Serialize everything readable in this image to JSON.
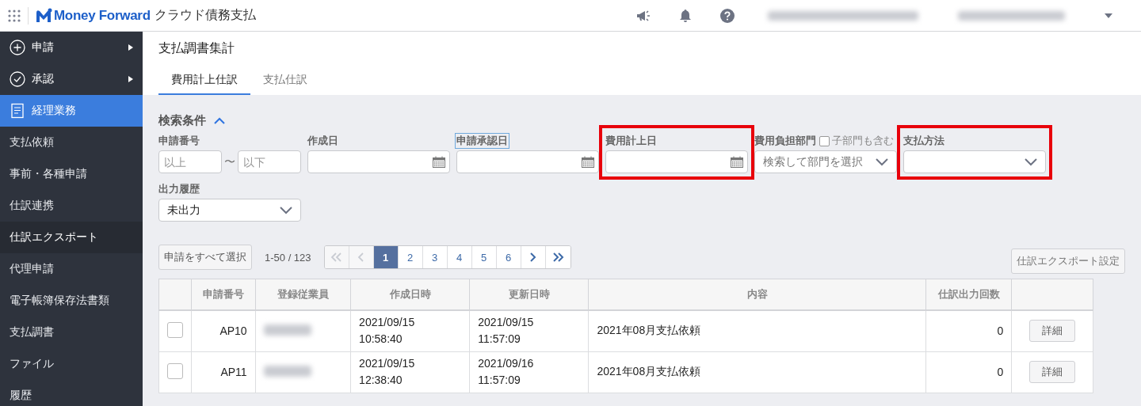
{
  "header": {
    "logo_text": "Money Forward",
    "app_name": "クラウド債務支払"
  },
  "sidebar": {
    "items": [
      {
        "label": "申請",
        "kind": "expandable"
      },
      {
        "label": "承認",
        "kind": "expandable"
      },
      {
        "label": "経理業務",
        "kind": "section",
        "selected": true
      },
      {
        "label": "支払依頼",
        "kind": "link",
        "selected": false
      },
      {
        "label": "事前・各種申請",
        "kind": "link",
        "selected": false
      },
      {
        "label": "仕訳連携",
        "kind": "link",
        "selected": false
      },
      {
        "label": "仕訳エクスポート",
        "kind": "link",
        "selected": true
      },
      {
        "label": "代理申請",
        "kind": "link",
        "selected": false
      },
      {
        "label": "電子帳簿保存法書類",
        "kind": "link",
        "selected": false
      },
      {
        "label": "支払調書",
        "kind": "link",
        "selected": false
      },
      {
        "label": "ファイル",
        "kind": "link",
        "selected": false
      },
      {
        "label": "履歴",
        "kind": "link",
        "selected": false
      }
    ]
  },
  "page": {
    "title": "支払調書集計",
    "tabs": [
      {
        "label": "費用計上仕訳",
        "selected": true
      },
      {
        "label": "支払仕訳",
        "selected": false
      }
    ],
    "search": {
      "title": "検索条件",
      "expanded": true,
      "fields": [
        {
          "kind": "range",
          "label": "申請番号",
          "from_placeholder": "以上",
          "separator": "〜",
          "to_placeholder": "以下",
          "focused": false,
          "highlighted": false
        },
        {
          "kind": "date",
          "label": "作成日",
          "focused": false,
          "highlighted": false
        },
        {
          "kind": "date",
          "label": "申請承認日",
          "focused": true,
          "highlighted": false
        },
        {
          "kind": "date",
          "label": "費用計上日",
          "focused": false,
          "highlighted": true
        },
        {
          "kind": "department",
          "label": "費用負担部門",
          "checkbox_label": "子部門も含む",
          "checked": false,
          "placeholder": "検索して部門を選択",
          "focused": false,
          "highlighted": false
        },
        {
          "kind": "select",
          "label": "支払方法",
          "focused": false,
          "highlighted": true
        },
        {
          "kind": "select",
          "label": "出力履歴",
          "value": "未出力",
          "focused": false,
          "highlighted": false
        }
      ]
    },
    "select_all_button": "申請をすべて選択",
    "range_text": "1-50 / 123",
    "pagination": [
      {
        "kind": "first",
        "disabled": true,
        "selected": false
      },
      {
        "kind": "prev",
        "disabled": true,
        "selected": false
      },
      {
        "kind": "page",
        "label": "1",
        "disabled": false,
        "selected": true
      },
      {
        "kind": "page",
        "label": "2",
        "disabled": false,
        "selected": false
      },
      {
        "kind": "page",
        "label": "3",
        "disabled": false,
        "selected": false
      },
      {
        "kind": "page",
        "label": "4",
        "disabled": false,
        "selected": false
      },
      {
        "kind": "page",
        "label": "5",
        "disabled": false,
        "selected": false
      },
      {
        "kind": "page",
        "label": "6",
        "disabled": false,
        "selected": false
      },
      {
        "kind": "next",
        "disabled": false,
        "selected": false
      },
      {
        "kind": "last",
        "disabled": false,
        "selected": false
      }
    ],
    "export_settings_button": "仕訳エクスポート設定",
    "table": {
      "columns": [
        "申請番号",
        "登録従業員",
        "作成日時",
        "更新日時",
        "内容",
        "仕訳出力回数"
      ],
      "rows": [
        {
          "checked": false,
          "number": "AP10",
          "created": [
            "2021/09/15",
            "10:58:40"
          ],
          "updated": [
            "2021/09/15",
            "11:57:09"
          ],
          "content": "2021年08月支払依頼",
          "export_count": "0",
          "action": "詳細"
        },
        {
          "checked": false,
          "number": "AP11",
          "created": [
            "2021/09/15",
            "12:38:40"
          ],
          "updated": [
            "2021/09/16",
            "11:57:09"
          ],
          "content": "2021年08月支払依頼",
          "export_count": "0",
          "action": "詳細"
        }
      ]
    }
  }
}
